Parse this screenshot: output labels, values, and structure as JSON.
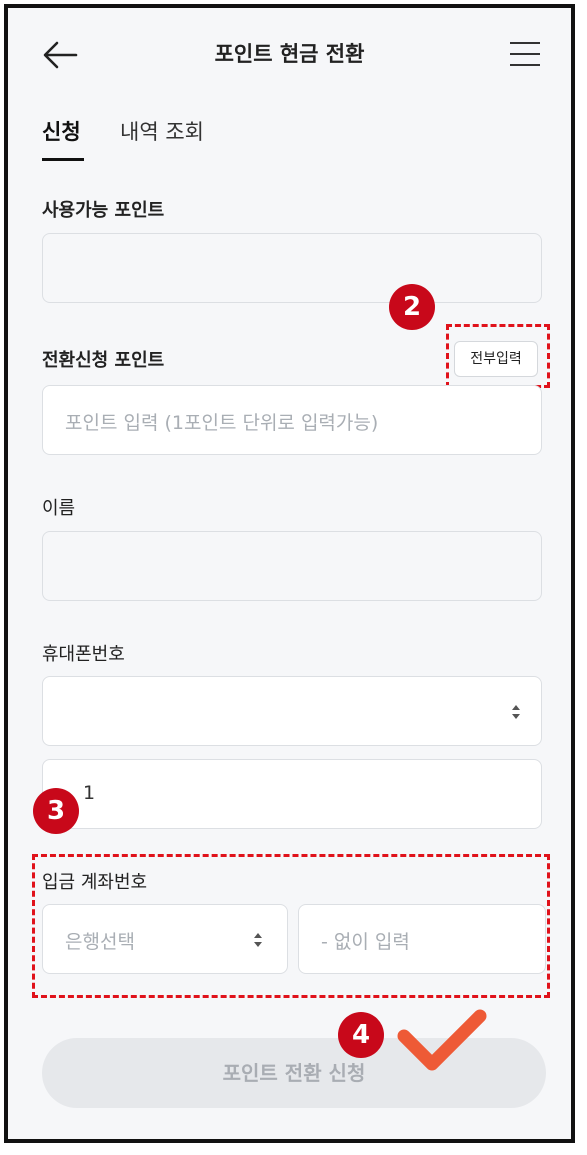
{
  "header": {
    "title": "포인트 현금 전환",
    "back_icon": "arrow-left-icon",
    "menu_icon": "hamburger-menu-icon"
  },
  "tabs": [
    {
      "label": "신청",
      "active": true
    },
    {
      "label": "내역 조회",
      "active": false
    }
  ],
  "available_points": {
    "label": "사용가능 포인트",
    "value": ""
  },
  "convert_points": {
    "label": "전환신청 포인트",
    "placeholder": "포인트 입력 (1포인트 단위로 입력가능)",
    "all_button": "전부입력"
  },
  "name": {
    "label": "이름",
    "value": ""
  },
  "phone": {
    "label": "휴대폰번호",
    "carrier_value": "",
    "number_value": "1"
  },
  "account": {
    "label": "입금 계좌번호",
    "bank_placeholder": "은행선택",
    "number_placeholder": "- 없이 입력"
  },
  "submit_label": "포인트 전환 신청",
  "annotations": {
    "badge_2": "2",
    "badge_3": "3",
    "badge_4": "4"
  },
  "colors": {
    "annotation_red": "#e0121b",
    "badge_red": "#c8081a",
    "check_orange": "#ee5a36"
  }
}
